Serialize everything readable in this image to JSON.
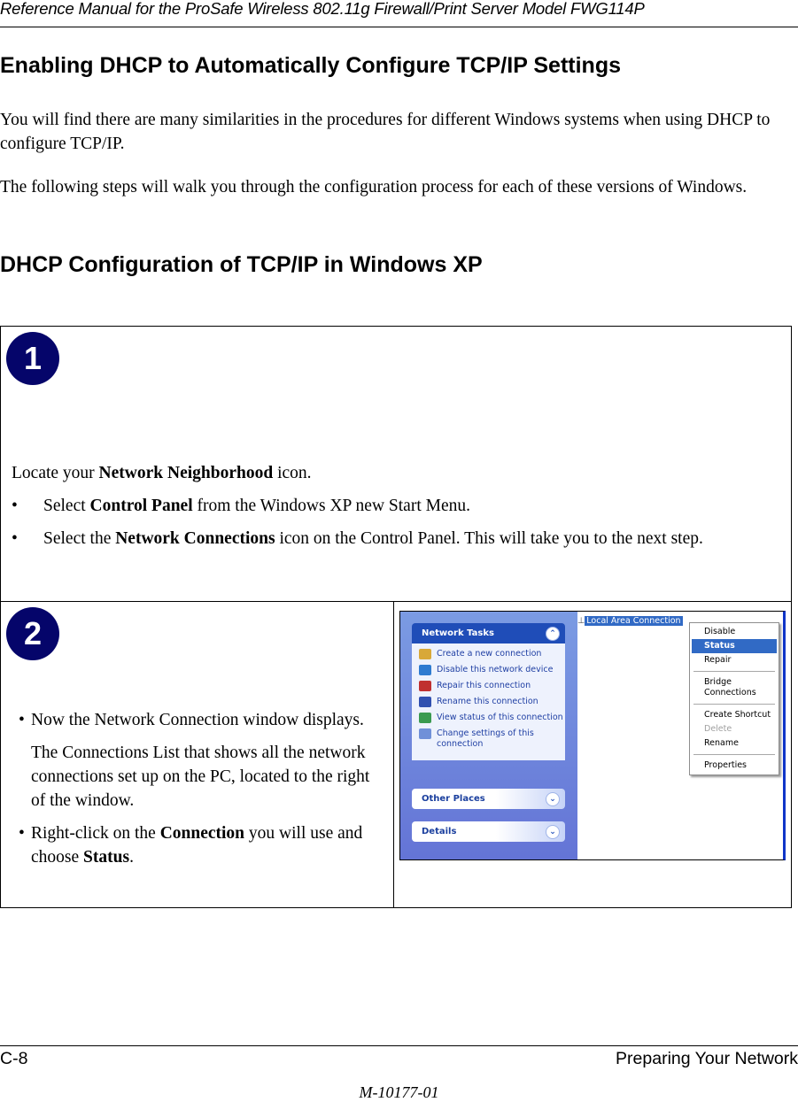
{
  "header": {
    "title": "Reference Manual for the ProSafe Wireless 802.11g  Firewall/Print Server Model FWG114P"
  },
  "section": {
    "title": "Enabling DHCP to Automatically Configure TCP/IP Settings",
    "para1": "You will find there are many similarities in the procedures for different Windows systems when using DHCP to configure TCP/IP.",
    "para2": "The following steps will walk you through the configuration process for each of these versions of Windows."
  },
  "subsection": {
    "title": "DHCP Configuration of TCP/IP in Windows XP"
  },
  "step1": {
    "number": "1",
    "intro_pre": "Locate your ",
    "intro_bold": "Network Neighborhood",
    "intro_post": " icon.",
    "bullets": [
      {
        "pre": "Select ",
        "bold": "Control Panel",
        "post": " from the Windows XP new Start Menu."
      },
      {
        "pre": "Select the ",
        "bold": "Network Connections",
        "post": " icon on the Control Panel.  This will take you to the next step."
      }
    ]
  },
  "step2": {
    "number": "2",
    "bullet1": "Now the Network Connection window displays.",
    "para": "The Connections List that shows all the network connections set up on the PC, located to the right of the window.",
    "bullet2_pre": "Right-click on the ",
    "bullet2_bold1": "Connection",
    "bullet2_mid": " you will use and choose ",
    "bullet2_bold2": "Status",
    "bullet2_post": "."
  },
  "screenshot": {
    "network_tasks_title": "Network Tasks",
    "tasks": [
      {
        "label": "Create a new connection",
        "icon": "new-connection-icon",
        "color": "#d8a838"
      },
      {
        "label": "Disable this network device",
        "icon": "disable-device-icon",
        "color": "#2e7bd0"
      },
      {
        "label": "Repair this connection",
        "icon": "repair-icon",
        "color": "#c03030"
      },
      {
        "label": "Rename this connection",
        "icon": "rename-icon",
        "color": "#3050b0"
      },
      {
        "label": "View status of this connection",
        "icon": "view-status-icon",
        "color": "#3a9a50"
      },
      {
        "label": "Change settings of this connection",
        "icon": "change-settings-icon",
        "color": "#7090d8"
      }
    ],
    "other_places": "Other Places",
    "details": "Details",
    "connection_name": "Local Area Connection",
    "context_menu": [
      {
        "label": "Disable",
        "state": "normal"
      },
      {
        "label": "Status",
        "state": "highlighted"
      },
      {
        "label": "Repair",
        "state": "normal"
      },
      {
        "sep": true
      },
      {
        "label": "Bridge Connections",
        "state": "normal"
      },
      {
        "sep": true
      },
      {
        "label": "Create Shortcut",
        "state": "normal"
      },
      {
        "label": "Delete",
        "state": "disabled"
      },
      {
        "label": "Rename",
        "state": "normal"
      },
      {
        "sep": true
      },
      {
        "label": "Properties",
        "state": "normal"
      }
    ]
  },
  "footer": {
    "left": "C-8",
    "right": "Preparing Your Network",
    "doc_id": "M-10177-01"
  }
}
